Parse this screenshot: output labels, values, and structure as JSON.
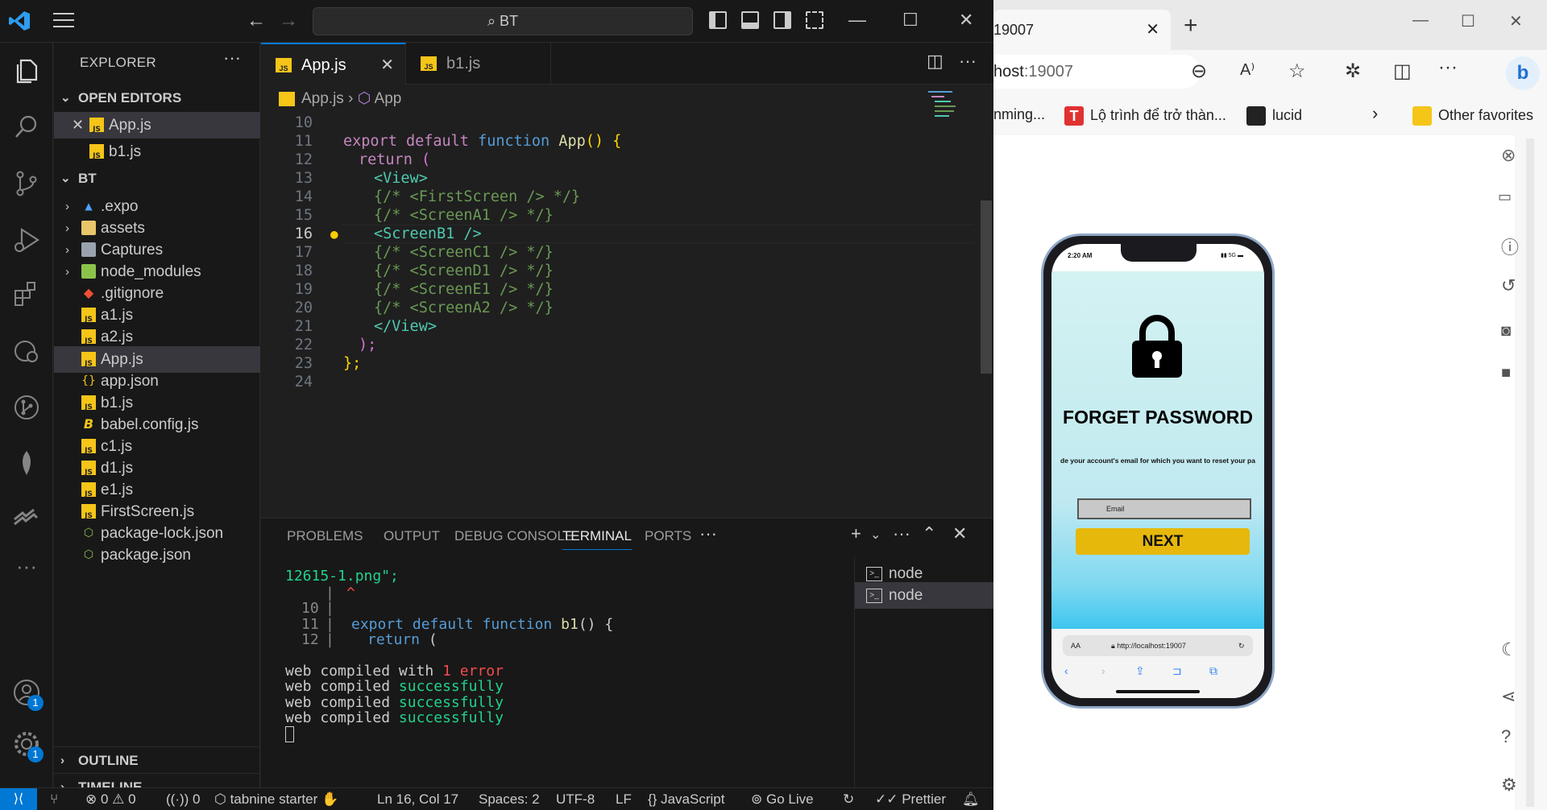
{
  "vscode": {
    "title_search": "BT",
    "sidebar": {
      "title": "EXPLORER",
      "open_editors_label": "OPEN EDITORS",
      "open_editors": [
        "App.js",
        "b1.js"
      ],
      "project_label": "BT",
      "files": [
        ".expo",
        "assets",
        "Captures",
        "node_modules",
        ".gitignore",
        "a1.js",
        "a2.js",
        "App.js",
        "app.json",
        "b1.js",
        "babel.config.js",
        "c1.js",
        "d1.js",
        "e1.js",
        "FirstScreen.js",
        "package-lock.json",
        "package.json"
      ],
      "outline_label": "OUTLINE",
      "timeline_label": "TIMELINE",
      "accounts_badge": "1",
      "settings_badge": "1"
    },
    "tabs": [
      "App.js",
      "b1.js"
    ],
    "breadcrumb": {
      "file": "App.js",
      "symbol": "App"
    },
    "line_numbers": [
      "10",
      "11",
      "12",
      "13",
      "14",
      "15",
      "16",
      "17",
      "18",
      "19",
      "20",
      "21",
      "22",
      "23",
      "24"
    ],
    "code": {
      "l11_export": "export",
      "l11_default": "default",
      "l11_function": "function",
      "l11_name": "App",
      "l11_rest": "() {",
      "l12_return": "return",
      "l12_paren": "(",
      "l13": "<View>",
      "l14": "{/* <FirstScreen /> */}",
      "l15": "{/* <ScreenA1 /> */}",
      "l16": "<ScreenB1 />",
      "l17": "{/* <ScreenC1 /> */}",
      "l18": "{/* <ScreenD1 /> */}",
      "l19": "{/* <ScreenE1 /> */}",
      "l20": "{/* <ScreenA2 /> */}",
      "l21": "</View>",
      "l22": ");",
      "l23": "};"
    },
    "panel": {
      "tabs": [
        "PROBLEMS",
        "OUTPUT",
        "DEBUG CONSOLE",
        "TERMINAL",
        "PORTS"
      ],
      "terminal_lines": {
        "t1": "12615-1.png\";",
        "t2_caret": "^",
        "t3_num": "10",
        "t4_num": "11",
        "t4_code_export": "export",
        "t4_code_default": "default",
        "t4_code_function": "function",
        "t4_code_name": "b1",
        "t4_code_rest": "() {",
        "t5_num": "12",
        "t5_code_return": "return",
        "t5_code_rest": "(",
        "t6_prefix": "web compiled with",
        "t6_count": "1",
        "t6_error": "error",
        "t7_prefix": "web compiled",
        "t7_status": "successfully"
      },
      "terminals": [
        "node",
        "node"
      ]
    },
    "status": {
      "errors": "0",
      "warnings": "0",
      "ports": "0",
      "tabnine": "tabnine starter",
      "position": "Ln 16, Col 17",
      "spaces": "Spaces: 2",
      "encoding": "UTF-8",
      "eol": "LF",
      "language": "JavaScript",
      "golive": "Go Live",
      "prettier": "Prettier"
    }
  },
  "browser": {
    "tab_title": "19007",
    "url_host": "host",
    "url_port": ":19007",
    "favorites": [
      "nming...",
      "Lộ trình để trở thàn...",
      "lucid",
      "Other favorites"
    ],
    "phone": {
      "time": "2:20 AM",
      "signal": "5G",
      "title": "FORGET PASSWORD",
      "description": "de your account's email for which you want to reset your pa",
      "email_placeholder": "Email",
      "next_label": "NEXT",
      "address_aa": "AA",
      "address_url": "http://localhost:19007"
    }
  }
}
